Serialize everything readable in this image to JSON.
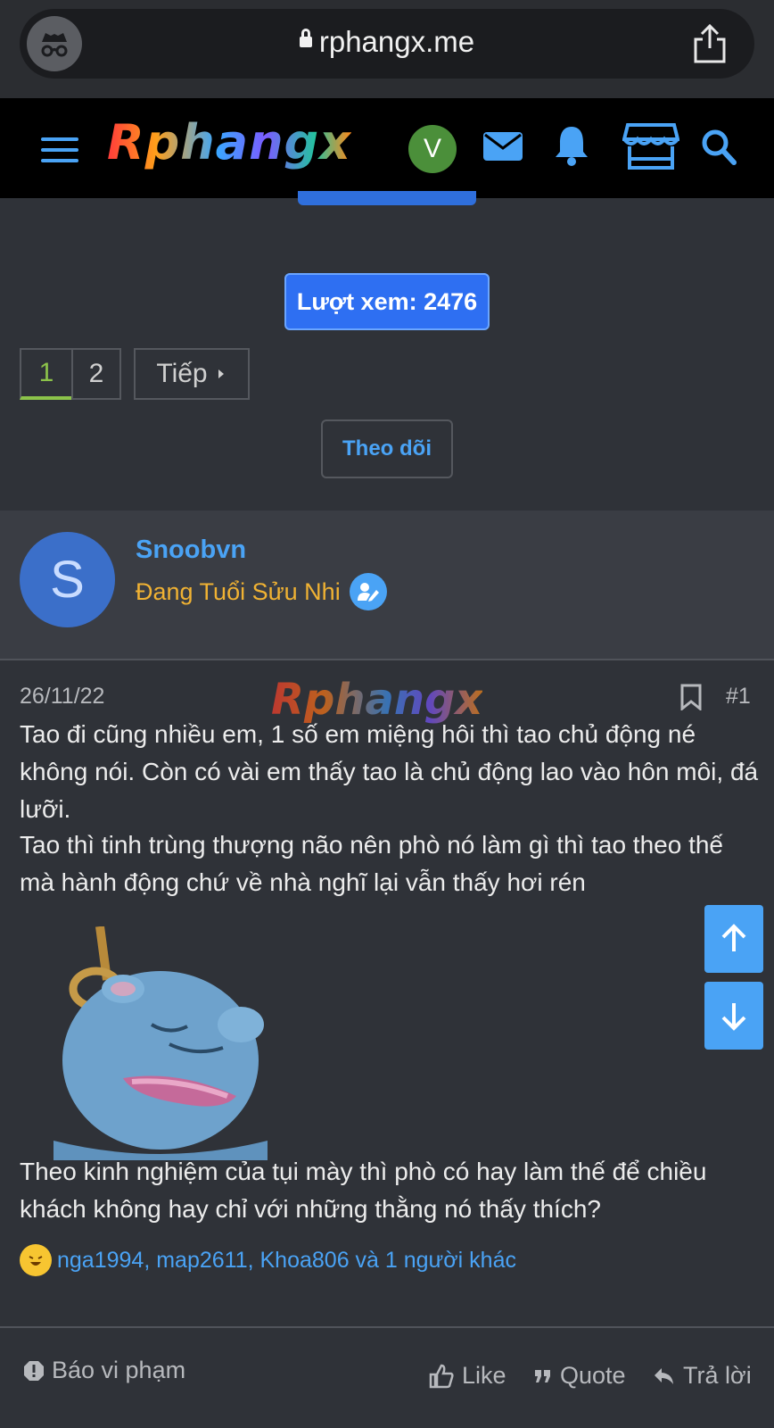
{
  "browser": {
    "url": "rphangx.me"
  },
  "header": {
    "logo": "Rphangx",
    "avatar_letter": "V"
  },
  "thread": {
    "views_label": "Lượt xem: 2476",
    "pages": [
      "1",
      "2"
    ],
    "current_page": "1",
    "next_label": "Tiếp",
    "follow_label": "Theo dõi"
  },
  "user": {
    "avatar_letter": "S",
    "name": "Snoobvn",
    "title": "Đang Tuổi Sửu Nhi"
  },
  "post": {
    "date": "26/11/22",
    "watermark": "Rphangx",
    "number": "#1",
    "paragraph1": "Tao đi cũng nhiều em, 1 số em miệng hôi thì tao chủ động né không nói. Còn có vài em thấy tao là chủ động lao vào hôn môi, đá lưỡi.",
    "paragraph2": "Tao thì tinh trùng thượng não nên phò nó làm gì thì tao theo thế mà hành động chứ về nhà nghĩ lại vẫn thấy hơi rén",
    "paragraph3": "Theo kinh nghiệm của tụi mày thì phò có hay làm thế để chiều khách không hay chỉ với những thằng nó thấy thích?",
    "reactions": "nga1994, map2611, Khoa806 và 1 người khác"
  },
  "actions": {
    "report": "Báo vi phạm",
    "like": "Like",
    "quote": "Quote",
    "reply": "Trả lời"
  },
  "colors": {
    "accent": "#4aa3f5",
    "views_button": "#2e6ff2",
    "title_gold": "#f0b233",
    "page_active": "#8cc34a"
  }
}
